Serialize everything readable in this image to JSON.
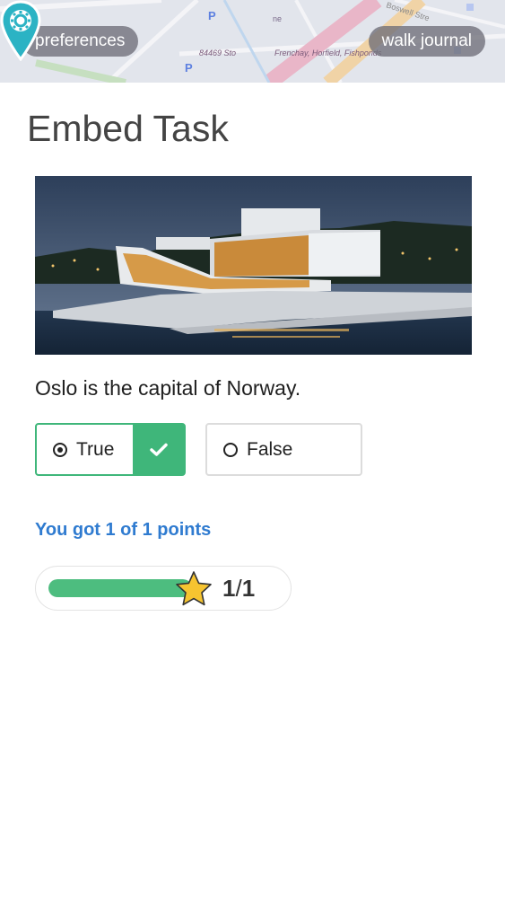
{
  "header": {
    "left_button": "preferences",
    "right_button": "walk journal",
    "map_labels": [
      "84469 Sto",
      "Frenchay, Horfield, Fishponds",
      "Boswell Stre",
      "P",
      "P",
      "ne"
    ]
  },
  "page_title": "Embed Task",
  "photo": {
    "subject": "Oslo Opera House"
  },
  "question": "Oslo is the capital of Norway.",
  "answers": [
    {
      "label": "True",
      "selected": true,
      "correct": true
    },
    {
      "label": "False",
      "selected": false,
      "correct": false
    }
  ],
  "score": {
    "text": "You got 1 of 1 points",
    "earned": "1",
    "separator": "/",
    "total": "1",
    "fraction": 1.0
  },
  "colors": {
    "correct_green": "#3fb67a",
    "score_blue": "#2f7bd0",
    "pin_teal": "#2bb3c4",
    "star_yellow": "#f6c430"
  }
}
